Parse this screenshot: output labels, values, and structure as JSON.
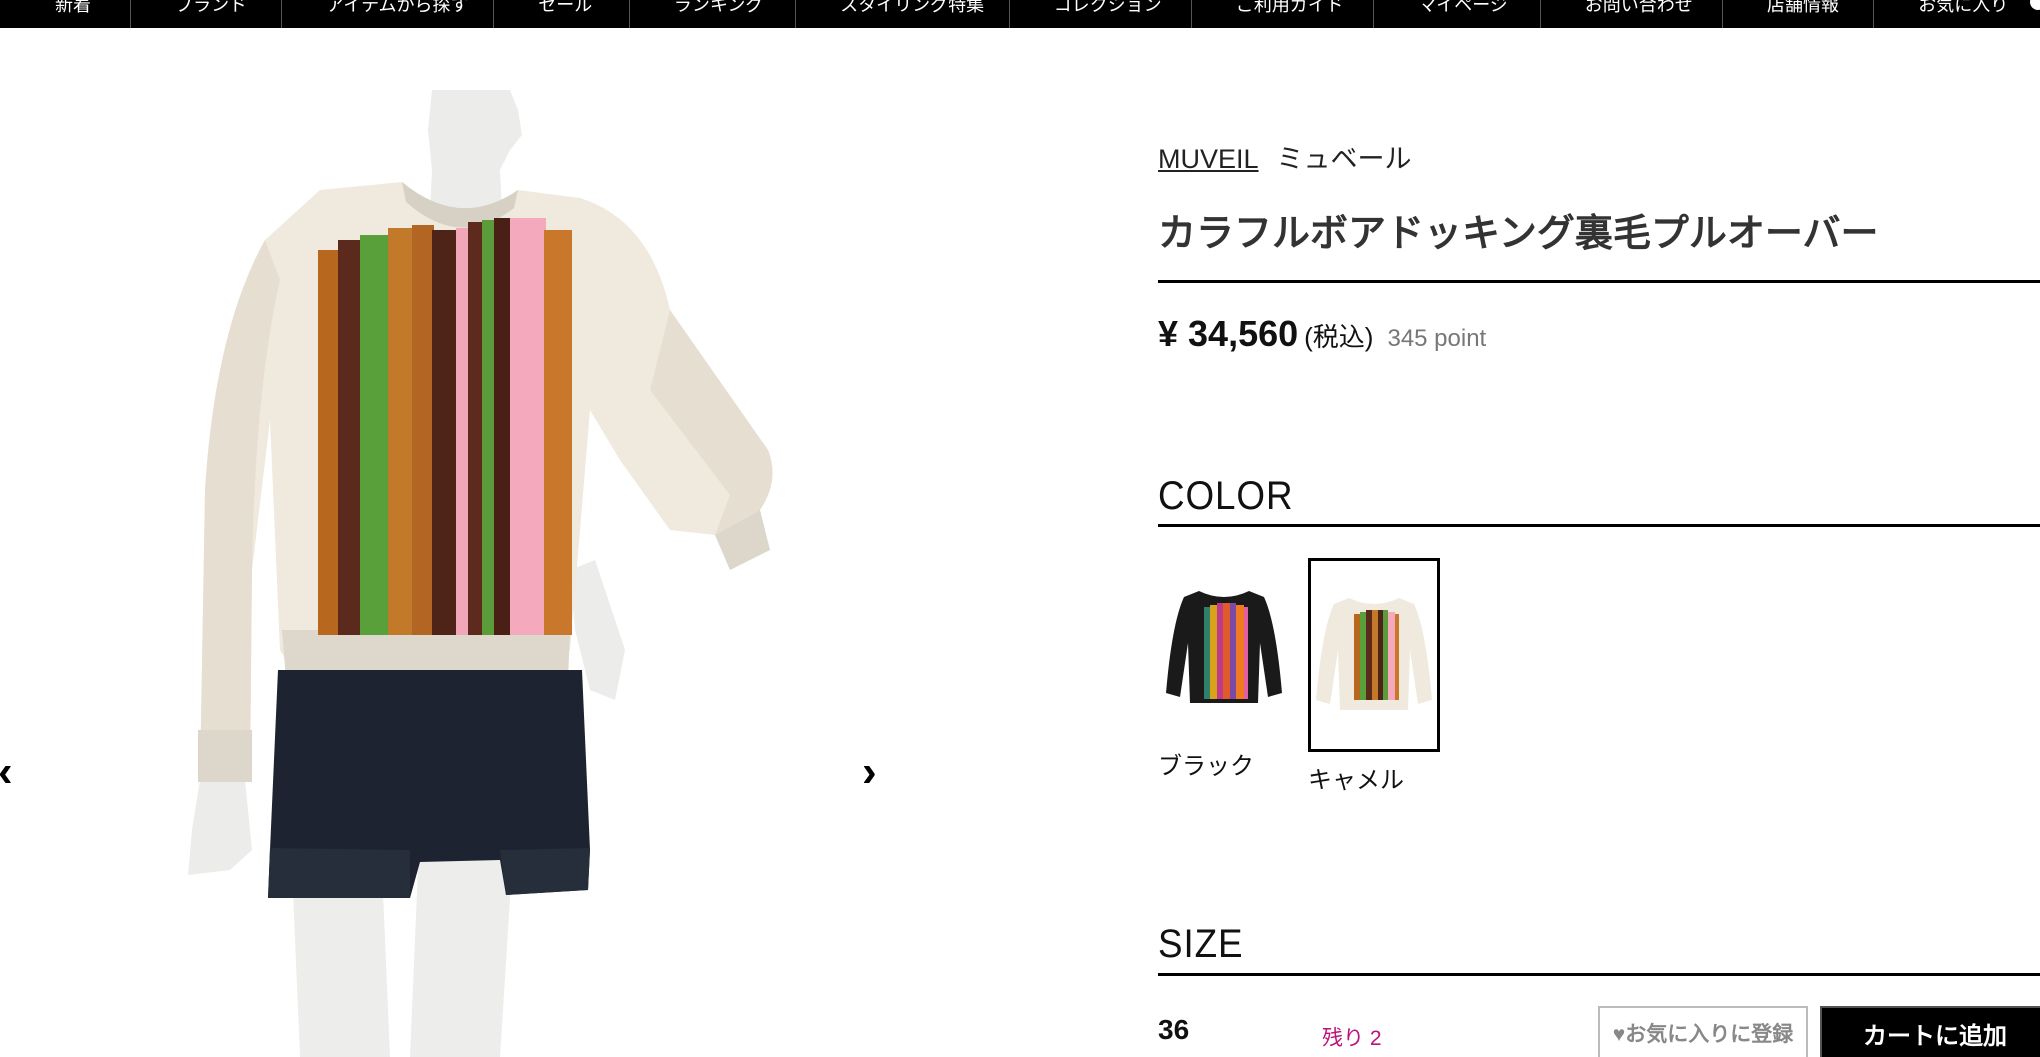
{
  "nav": {
    "items": [
      "新着",
      "ブランド",
      "アイテムから探す",
      "セール",
      "ランキング",
      "スタイリング特集",
      "コレクション",
      "ご利用ガイド",
      "マイページ",
      "お問い合わせ",
      "店舗情報",
      "お気に入り"
    ]
  },
  "gallery": {
    "prev_label": "‹",
    "next_label": "›",
    "image_alt": "カラフルボアドッキング裏毛プルオーバー"
  },
  "product": {
    "brand": "MUVEIL",
    "brand_kana": "ミュベール",
    "title": "カラフルボアドッキング裏毛プルオーバー",
    "price": "¥ 34,560",
    "tax_note": "(税込)",
    "points": "345 point"
  },
  "color": {
    "heading": "COLOR",
    "options": [
      {
        "label": "ブラック",
        "selected": false
      },
      {
        "label": "キャメル",
        "selected": true
      }
    ]
  },
  "size": {
    "heading": "SIZE",
    "rows": [
      {
        "size": "36",
        "stock": "残り 2",
        "favorite_label": "♥お気に入りに登録",
        "cart_label": "カートに追加"
      }
    ]
  },
  "colors": {
    "accent_stock": "#c0117a",
    "nav_bg": "#000000"
  }
}
